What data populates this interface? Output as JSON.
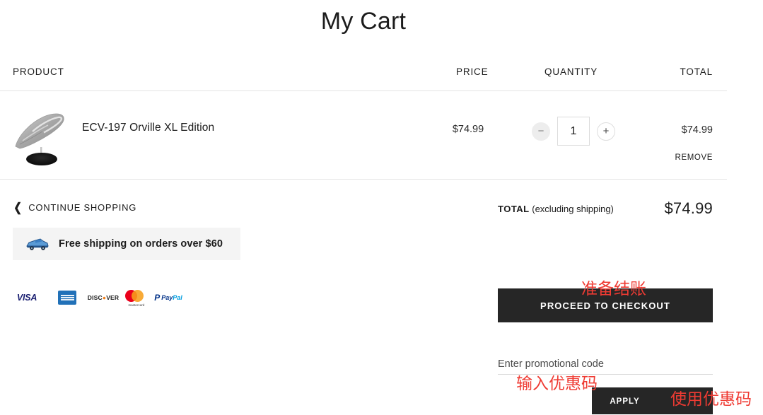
{
  "page": {
    "title": "My Cart"
  },
  "table": {
    "headers": {
      "product": "PRODUCT",
      "price": "PRICE",
      "quantity": "QUANTITY",
      "total": "TOTAL"
    }
  },
  "items": [
    {
      "name": "ECV-197 Orville XL Edition",
      "price": "$74.99",
      "quantity": "1",
      "line_total": "$74.99",
      "remove_label": "REMOVE",
      "decrease_label": "−",
      "increase_label": "+",
      "thumb_icon": "spaceship-model-icon"
    }
  ],
  "actions": {
    "continue_shopping": "CONTINUE SHOPPING",
    "back_chevron_icon": "❮"
  },
  "shipping_banner": {
    "text": "Free shipping on orders over $60",
    "icon": "truck-icon"
  },
  "payment_methods": [
    {
      "name": "Visa",
      "label": "VISA"
    },
    {
      "name": "American Express",
      "label": "AMERICAN EXPRESS"
    },
    {
      "name": "Discover",
      "label_pre": "DISC",
      "label_o": "●",
      "label_post": "VER"
    },
    {
      "name": "Mastercard",
      "label": "mastercard"
    },
    {
      "name": "PayPal",
      "mark": "P",
      "label_a": "Pay",
      "label_b": "Pal"
    }
  ],
  "summary": {
    "total_label": "TOTAL",
    "total_note": "(excluding shipping)",
    "total_amount": "$74.99",
    "checkout_label": "PROCEED TO CHECKOUT",
    "promo_placeholder": "Enter promotional code",
    "promo_value": "",
    "apply_label": "APPLY"
  },
  "annotations": {
    "checkout": "准备结账",
    "promo_input": "输入优惠码",
    "apply": "使用优惠码",
    "color": "#ef3b33"
  }
}
